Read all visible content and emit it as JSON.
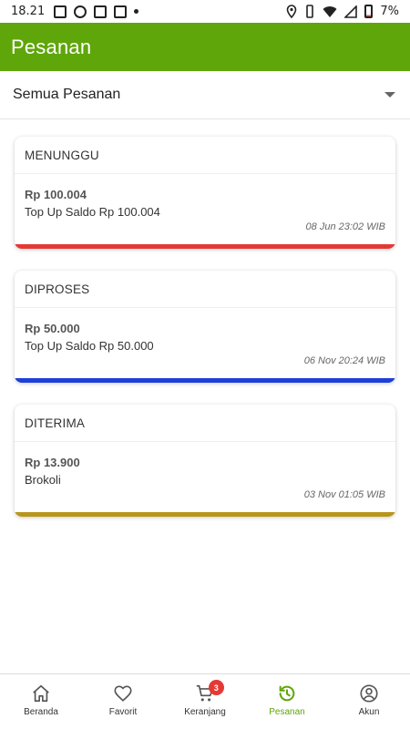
{
  "status_bar": {
    "time": "18.21",
    "battery": "7%"
  },
  "app_bar": {
    "title": "Pesanan"
  },
  "filter": {
    "selected": "Semua Pesanan"
  },
  "orders": [
    {
      "status": "MENUNGGU",
      "price": "Rp 100.004",
      "description": "Top Up Saldo Rp 100.004",
      "date": "08 Jun 23:02 WIB",
      "status_color": "#e53935"
    },
    {
      "status": "DIPROSES",
      "price": "Rp 50.000",
      "description": "Top Up Saldo Rp 50.000",
      "date": "06 Nov 20:24 WIB",
      "status_color": "#1e3fd8"
    },
    {
      "status": "DITERIMA",
      "price": "Rp 13.900",
      "description": "Brokoli",
      "date": "03 Nov 01:05 WIB",
      "status_color": "#b8961c"
    }
  ],
  "bottom_nav": {
    "items": [
      {
        "label": "Beranda",
        "icon": "home-icon"
      },
      {
        "label": "Favorit",
        "icon": "heart-icon"
      },
      {
        "label": "Keranjang",
        "icon": "cart-icon",
        "badge": "3"
      },
      {
        "label": "Pesanan",
        "icon": "history-icon",
        "active": true
      },
      {
        "label": "Akun",
        "icon": "account-icon"
      }
    ]
  },
  "colors": {
    "primary": "#5fa60a",
    "badge": "#e53935"
  }
}
